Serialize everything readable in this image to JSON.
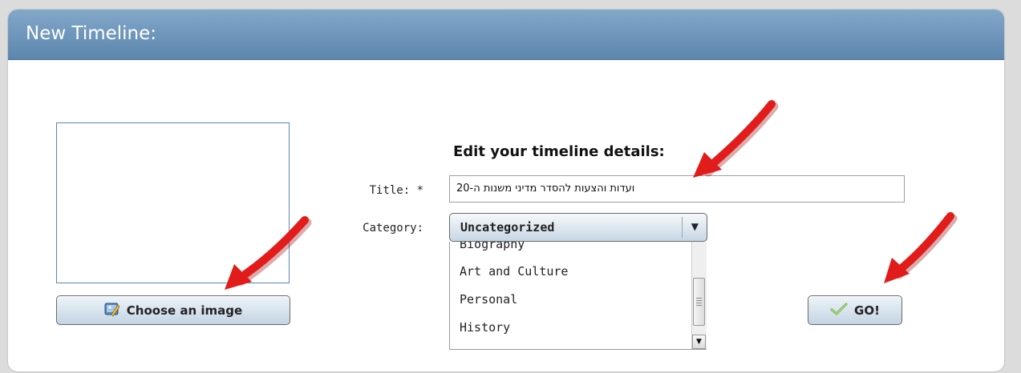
{
  "header": {
    "title": "New Timeline:"
  },
  "form": {
    "heading": "Edit your timeline details:",
    "title_label": "Title: *",
    "title_value": "ועדות והצעות להסדר מדיני משנות ה-20",
    "category_label": "Category:",
    "category_selected": "Uncategorized",
    "category_options": [
      "Biography",
      "Art and Culture",
      "Personal",
      "History"
    ]
  },
  "buttons": {
    "choose_image": "Choose an image",
    "go": "GO!"
  },
  "colors": {
    "header_bg": "#6891b8",
    "annotation_arrow": "#e21b1b",
    "go_check": "#6db33f"
  },
  "icons": {
    "choose_image": "image-edit-icon",
    "go": "checkmark-icon",
    "select": "chevron-down-icon"
  }
}
